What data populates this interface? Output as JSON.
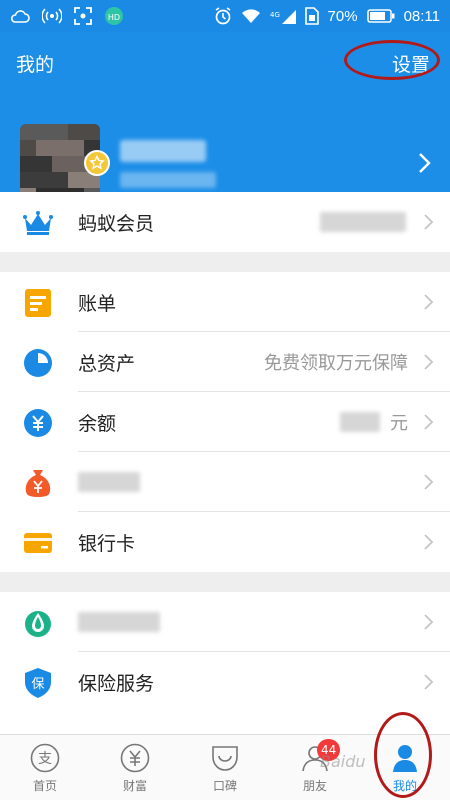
{
  "status_bar": {
    "battery": "70%",
    "time": "08:11",
    "network": "4G"
  },
  "header": {
    "title": "我的",
    "settings": "设置"
  },
  "rows": [
    {
      "label": "蚂蚁会员",
      "detail": "",
      "icon": "crown-icon"
    },
    {
      "label": "账单",
      "detail": "",
      "icon": "bill-icon"
    },
    {
      "label": "总资产",
      "detail": "免费领取万元保障",
      "icon": "assets-pie-icon"
    },
    {
      "label": "余额",
      "detail": "元",
      "icon": "balance-yuan-icon"
    },
    {
      "label": "",
      "detail": "",
      "icon": "money-bag-icon"
    },
    {
      "label": "银行卡",
      "detail": "",
      "icon": "bank-card-icon"
    },
    {
      "label": "",
      "detail": "",
      "icon": "fund-drop-icon"
    },
    {
      "label": "保险服务",
      "detail": "",
      "icon": "insurance-shield-icon"
    }
  ],
  "tabs": [
    {
      "label": "首页",
      "icon": "alipay-home-icon"
    },
    {
      "label": "财富",
      "icon": "wealth-yuan-icon"
    },
    {
      "label": "口碑",
      "icon": "koubei-bag-icon"
    },
    {
      "label": "朋友",
      "icon": "friends-icon",
      "badge": "44"
    },
    {
      "label": "我的",
      "icon": "me-person-icon"
    }
  ],
  "watermark": "Baidu",
  "colors": {
    "brand": "#1a8ae4",
    "accent_red": "#f23a3a",
    "annotation": "#b21a1a"
  }
}
